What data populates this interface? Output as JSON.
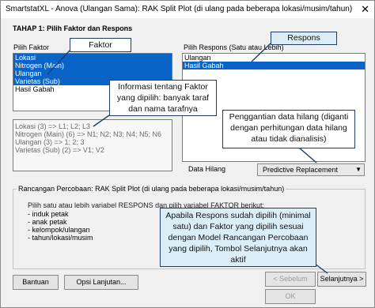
{
  "window": {
    "title": "SmartstatXL - Anova (Ulangan Sama):  RAK Split Plot (di ulang pada beberapa lokasi/musim/tahun)",
    "close_glyph": "✕"
  },
  "step": {
    "heading": "TAHAP 1: Pilih Faktor dan Respons"
  },
  "factors": {
    "label": "Pilih Faktor",
    "items": [
      {
        "text": "Lokasi",
        "selected": true
      },
      {
        "text": "Nitrogen (Main)",
        "selected": true
      },
      {
        "text": "Ulangan",
        "selected": true
      },
      {
        "text": "Varietas (Sub)",
        "selected": true
      },
      {
        "text": "Hasil Gabah",
        "selected": false
      }
    ]
  },
  "responses": {
    "label": "Pilih Respons (Satu atau Lebih)",
    "items": [
      {
        "text": "Ulangan",
        "selected": false
      },
      {
        "text": "Hasil Gabah",
        "selected": true
      }
    ]
  },
  "factor_info": {
    "lines": [
      "Lokasi (3) => L1; L2; L3",
      "Nitrogen (Main) (6) => N1; N2; N3; N4; N5; N6",
      "Ulangan (3) => 1; 2; 3",
      "Varietas (Sub) (2) => V1; V2"
    ]
  },
  "missing_data": {
    "label": "Data Hilang",
    "value": "Predictive Replacement"
  },
  "design": {
    "label": "Rancangan Percobaan: RAK Split Plot (di ulang pada beberapa lokasi/musim/tahun)",
    "instruction": "Pilih satu atau lebih variabel RESPONS dan pilih variabel FAKTOR berikut:",
    "requirements": [
      "- induk petak",
      "- anak petak",
      "- kelompok/ulangan",
      "- tahun/lokasi/musim"
    ]
  },
  "buttons": {
    "help": "Bantuan",
    "options": "Opsi Lanjutan...",
    "prev": "< Sebelum",
    "next": "Selanjutnya >",
    "ok": "OK"
  },
  "callouts": {
    "faktor": "Faktor",
    "respons": "Respons",
    "info": "Informasi tentang Faktor yang dipilih:  banyak taraf dan nama tarafnya",
    "missing": "Penggantian data hilang (diganti dengan perhitungan data hilang atau tidak dianalisis)",
    "next": "Apabila Respons sudah dipilih (minimal satu) dan Faktor yang dipilih sesuai dengan Model Rancangan Percobaan yang dipilih, Tombol Selanjutnya akan aktif"
  },
  "colors": {
    "selection": "#0a64c8",
    "callout_border": "#1f3c64",
    "callout_blue_fill": "#dbeef8"
  }
}
